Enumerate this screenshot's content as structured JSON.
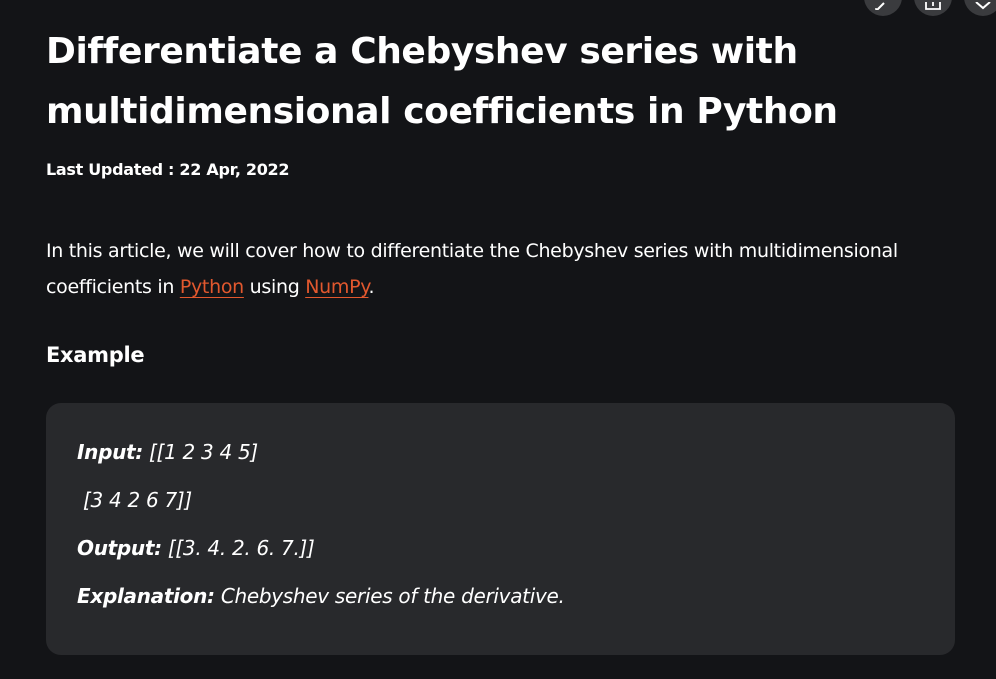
{
  "article": {
    "title": "Differentiate a Chebyshev series with multidimensional coefficients in Python",
    "last_updated": "Last Updated : 22 Apr, 2022",
    "intro": {
      "before": "In this article, we will cover how to differentiate the Chebyshev series with multidimensional coefficients in ",
      "link1": "Python",
      "middle": " using ",
      "link2": "NumPy",
      "after": "."
    }
  },
  "example": {
    "heading": "Example",
    "input_label": "Input:",
    "input_value": " [[1 2 3 4 5]",
    "input_value_2": " [3 4 2 6 7]]",
    "output_label": "Output:",
    "output_value": " [[3. 4. 2. 6. 7.]]",
    "explanation_label": "Explanation:",
    "explanation_value": " Chebyshev series of the derivative."
  },
  "actions": {
    "icons": [
      "edit-icon",
      "share-icon",
      "bookmark-icon"
    ]
  }
}
